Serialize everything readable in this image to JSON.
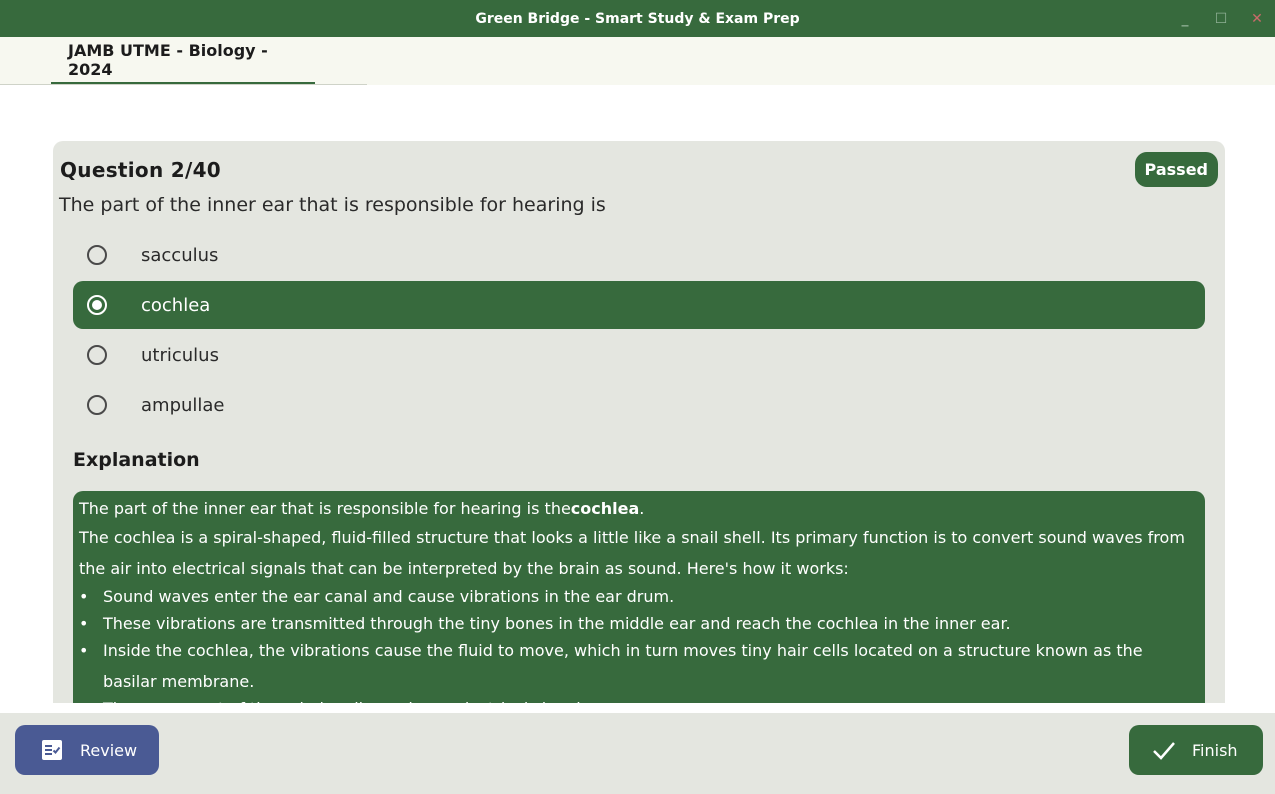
{
  "window": {
    "title": "Green Bridge - Smart Study & Exam Prep",
    "controls": {
      "minimize": "_",
      "maximize": "☐",
      "close": "✕"
    }
  },
  "tabs": [
    {
      "label": "JAMB UTME - Biology - 2024",
      "active": true
    }
  ],
  "question": {
    "header": "Question 2/40",
    "status_badge": "Passed",
    "text": "The part of the inner ear that is responsible for hearing is",
    "options": [
      {
        "label": "sacculus",
        "selected": false
      },
      {
        "label": "cochlea",
        "selected": true
      },
      {
        "label": "utriculus",
        "selected": false
      },
      {
        "label": "ampullae",
        "selected": false
      }
    ]
  },
  "explanation": {
    "title": "Explanation",
    "lead_text": "The part of the inner ear that is responsible for hearing is the",
    "lead_bold": "cochlea",
    "lead_end": ".",
    "paragraph": "The cochlea is a spiral-shaped, fluid-filled structure that looks a little like a snail shell. Its primary function is to convert sound waves from the air into electrical signals that can be interpreted by the brain as sound. Here's how it works:",
    "bullets": [
      "Sound waves enter the ear canal and cause vibrations in the ear drum.",
      "These vibrations are transmitted through the tiny bones in the middle ear and reach the cochlea in the inner ear.",
      "Inside the cochlea, the vibrations cause the fluid to move, which in turn moves tiny hair cells located on a structure known as the basilar membrane.",
      "The movement of these hair cells produces electrical signals."
    ]
  },
  "footer": {
    "review_label": "Review",
    "finish_label": "Finish"
  },
  "colors": {
    "primary_green": "#376a3d",
    "review_blue": "#4a5a94",
    "card_bg": "#e4e6e0"
  },
  "icons": {
    "review": "checklist-icon",
    "finish": "checkmark-icon"
  }
}
